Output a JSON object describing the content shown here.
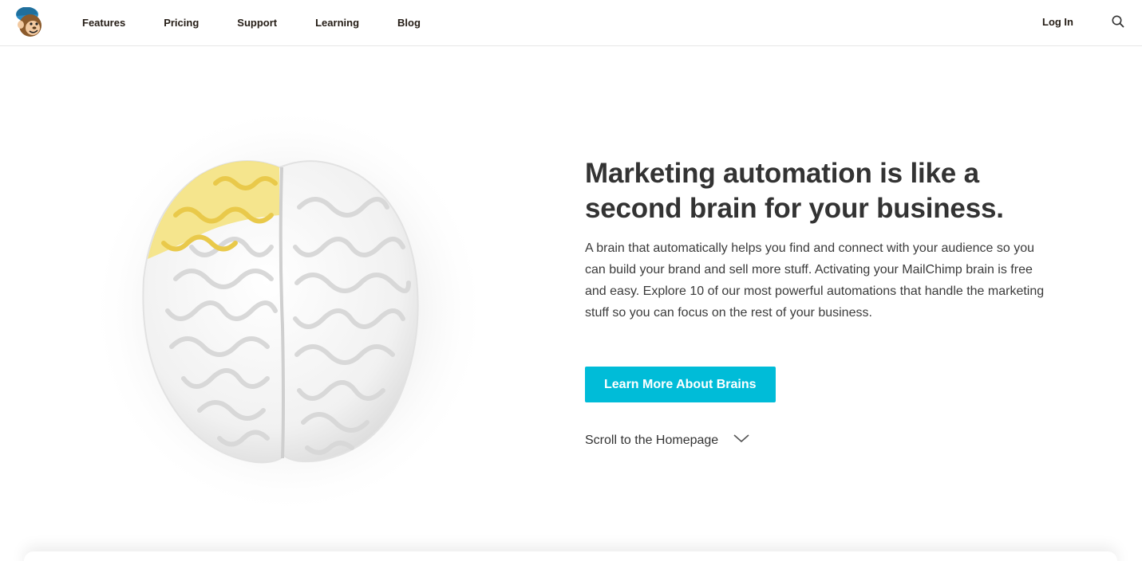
{
  "nav": {
    "logo_name": "mailchimp-freddie-logo",
    "items": [
      "Features",
      "Pricing",
      "Support",
      "Learning",
      "Blog"
    ],
    "login_label": "Log In",
    "search_icon": "search-icon"
  },
  "hero": {
    "headline": "Marketing automation is like a second brain for your business.",
    "body": "A brain that automatically helps you find and connect with your audience so you can build your brand and sell more stuff. Activating your MailChimp brain is free and easy. Explore 10 of our most powerful automations that handle the marketing stuff so you can focus on the rest of your business.",
    "cta_label": "Learn More About Brains",
    "scroll_label": "Scroll to the Homepage",
    "scroll_icon": "chevron-down-icon",
    "image": "brain-illustration"
  },
  "colors": {
    "accent": "#00bcd8",
    "text": "#333333",
    "brain_highlight": "#f5e27a"
  }
}
